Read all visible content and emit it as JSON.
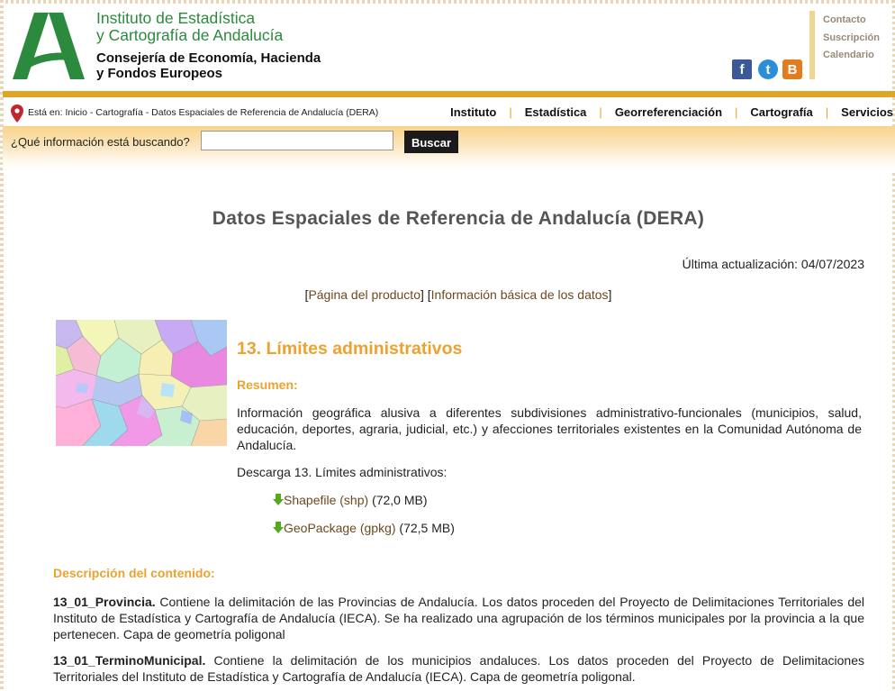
{
  "header": {
    "institute_line1": "Instituto de Estadística",
    "institute_line2": "y Cartografía de Andalucía",
    "consejeria_line1": "Consejería de Economía, Hacienda",
    "consejeria_line2": "y Fondos Europeos",
    "social": [
      {
        "name": "facebook-icon",
        "glyph": "f"
      },
      {
        "name": "twitter-icon",
        "glyph": "t"
      },
      {
        "name": "blog-icon",
        "glyph": "B"
      }
    ],
    "top_links": [
      "Contacto",
      "Suscripción",
      "Calendario"
    ]
  },
  "breadcrumb": "Está en: Inicio - Cartografía - Datos Espaciales de Referencia de Andalucía (DERA)",
  "nav": [
    "Instituto",
    "Estadística",
    "Georreferenciación",
    "Cartografía",
    "Servicios"
  ],
  "search": {
    "label": "¿Qué información está buscando?",
    "value": "",
    "button": "Buscar"
  },
  "main": {
    "title": "Datos Espaciales de Referencia de Andalucía (DERA)",
    "updated": "Última actualización: 04/07/2023",
    "links": {
      "product": "Página del producto",
      "info": "Información básica de los datos"
    },
    "section_title": "13. Límites administrativos",
    "summary_heading": "Resumen:",
    "summary_text": "Información geográfica alusiva a diferentes subdivisiones administrativo-funcionales (municipios, salud, educación, deportes, agraria, judicial, etc.) y afecciones territoriales existentes en la Comunidad Autónoma de Andalucía.",
    "download_label": "Descarga 13. Límites administrativos:",
    "downloads": [
      {
        "link": "Shapefile (shp)",
        "size": "(72,0 MB)"
      },
      {
        "link": "GeoPackage (gpkg)",
        "size": "(72,5 MB)"
      }
    ],
    "description_heading": "Descripción del contenido:",
    "items": [
      {
        "name": "13_01_Provincia.",
        "text": "Contiene la delimitación de las Provincias de Andalucía. Los datos proceden del Proyecto de Delimitaciones Territoriales del Instituto de Estadística y Cartografía de Andalucía (IECA). Se ha realizado una agrupación de los términos municipales por la provincia a la que pertenecen. Capa de geometría poligonal"
      },
      {
        "name": "13_01_TerminoMunicipal.",
        "text": "Contiene la delimitación de los municipios andaluces. Los datos proceden del Proyecto de Delimitaciones Territoriales del Instituto de Estadística y Cartografía de Andalucía (IECA). Capa de geometría poligonal."
      }
    ]
  },
  "colors": {
    "accent_orange": "#e0a524",
    "heading_orange": "#eba330",
    "brand_green": "#2b8a3e",
    "link_brown": "#6b4a1e"
  }
}
